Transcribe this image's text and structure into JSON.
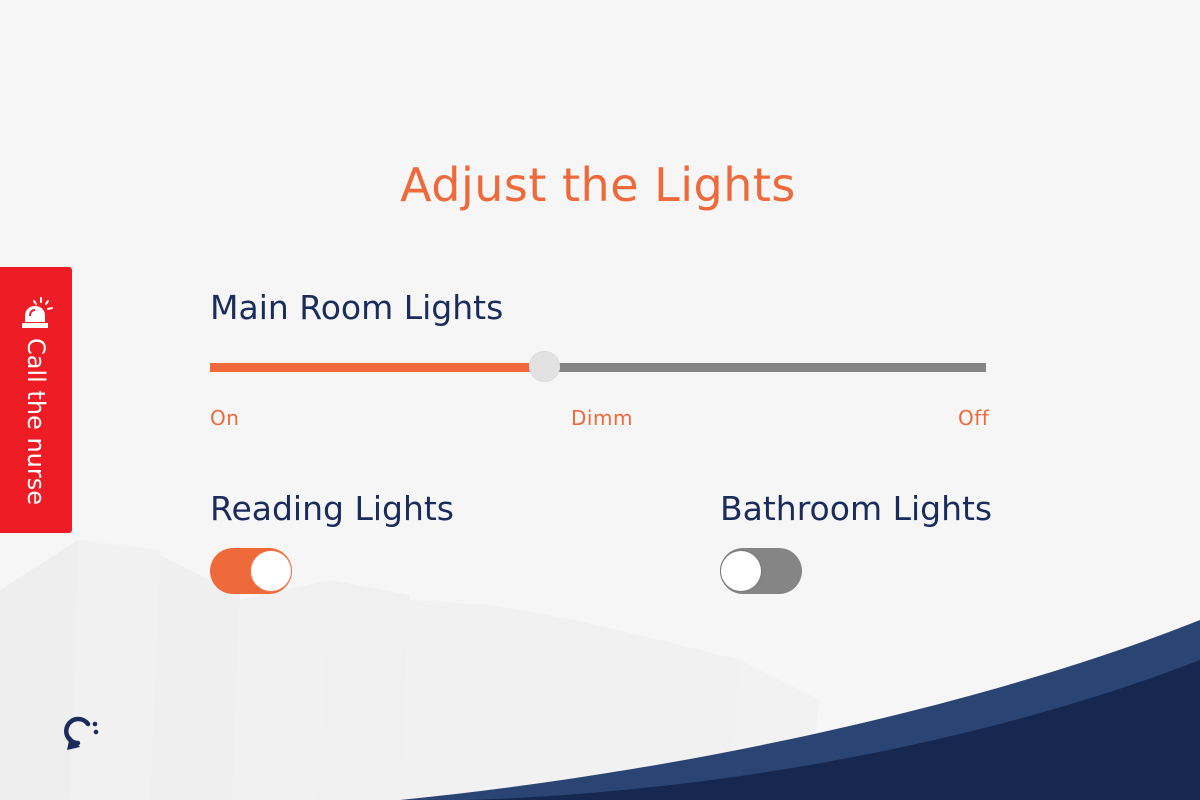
{
  "title": "Adjust the Lights",
  "main_lights": {
    "label": "Main Room Lights",
    "level": 0.43,
    "ticks": [
      "On",
      "Dimm",
      "Off"
    ]
  },
  "reading_lights": {
    "label": "Reading Lights",
    "state": "on"
  },
  "bathroom_lights": {
    "label": "Bathroom Lights",
    "state": "off"
  },
  "nurse_call": {
    "label": "Call the nurse",
    "icon": "siren-icon",
    "color": "#ee1c25"
  },
  "logo": {
    "icon": "rotate-arrow-logo"
  },
  "colors": {
    "accent": "#ee6a3a",
    "navy": "#1a2c5c",
    "track_inactive": "#858585",
    "background": "#f6f6f6"
  }
}
